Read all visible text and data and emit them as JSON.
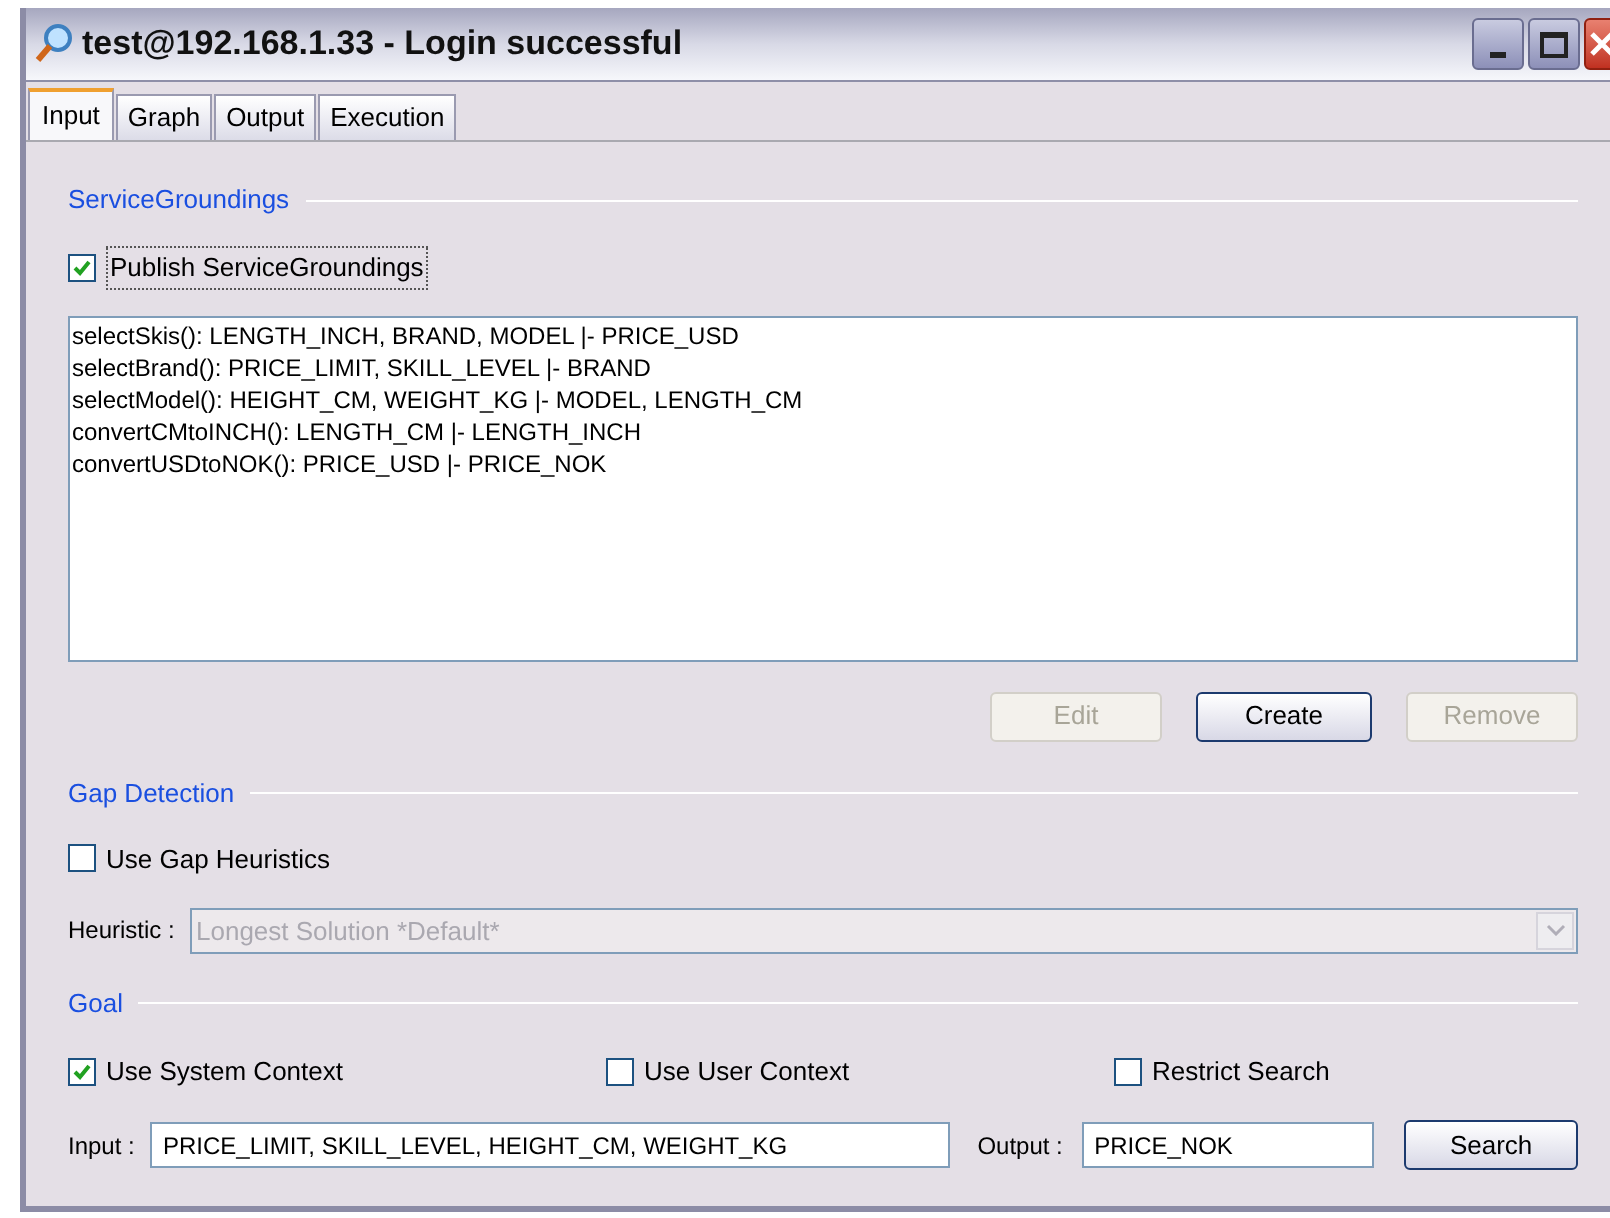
{
  "window": {
    "title": "test@192.168.1.33 - Login successful"
  },
  "tabs": [
    {
      "label": "Input",
      "selected": true
    },
    {
      "label": "Graph",
      "selected": false
    },
    {
      "label": "Output",
      "selected": false
    },
    {
      "label": "Execution",
      "selected": false
    }
  ],
  "service_groundings": {
    "heading": "ServiceGroundings",
    "publish": {
      "label": "Publish ServiceGroundings",
      "checked": true
    },
    "lines": [
      "selectSkis(): LENGTH_INCH, BRAND, MODEL |- PRICE_USD",
      "selectBrand(): PRICE_LIMIT, SKILL_LEVEL |- BRAND",
      "selectModel(): HEIGHT_CM, WEIGHT_KG |- MODEL, LENGTH_CM",
      "convertCMtoINCH(): LENGTH_CM |- LENGTH_INCH",
      "convertUSDtoNOK(): PRICE_USD |- PRICE_NOK"
    ],
    "buttons": [
      {
        "label": "Edit",
        "disabled": true
      },
      {
        "label": "Create",
        "disabled": false
      },
      {
        "label": "Remove",
        "disabled": true
      }
    ]
  },
  "gap_detection": {
    "heading": "Gap Detection",
    "use_gap_heuristics": {
      "label": "Use Gap Heuristics",
      "checked": false
    },
    "heuristic": {
      "label": "Heuristic :",
      "value": "Longest Solution *Default*",
      "disabled": true
    }
  },
  "goal": {
    "heading": "Goal",
    "options": [
      {
        "label": "Use System Context",
        "checked": true
      },
      {
        "label": "Use User Context",
        "checked": false
      },
      {
        "label": "Restrict Search",
        "checked": false
      }
    ],
    "input": {
      "label": "Input :",
      "value": "PRICE_LIMIT, SKILL_LEVEL, HEIGHT_CM, WEIGHT_KG"
    },
    "output": {
      "label": "Output :",
      "value": "PRICE_NOK"
    },
    "search_button": "Search"
  }
}
